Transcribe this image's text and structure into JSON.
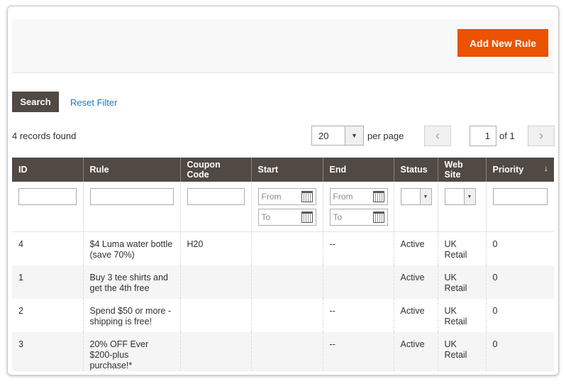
{
  "toolbar": {
    "add_label": "Add New Rule"
  },
  "filters": {
    "search_label": "Search",
    "reset_label": "Reset Filter"
  },
  "records_found": "4 records found",
  "pagination": {
    "per_page_value": "20",
    "per_page_label": "per page",
    "prev_icon": "‹",
    "next_icon": "›",
    "current_page": "1",
    "of_label": "of 1"
  },
  "grid": {
    "columns": [
      {
        "label": "ID"
      },
      {
        "label": "Rule"
      },
      {
        "label": "Coupon Code"
      },
      {
        "label": "Start"
      },
      {
        "label": "End"
      },
      {
        "label": "Status"
      },
      {
        "label": "Web Site"
      },
      {
        "label": "Priority"
      }
    ],
    "sort_icon": "↓",
    "date_from_placeholder": "From",
    "date_to_placeholder": "To",
    "rows": [
      {
        "id": "4",
        "rule": "$4 Luma water bottle (save 70%)",
        "coupon": "H20",
        "start": "",
        "end": "--",
        "status": "Active",
        "website": "UK Retail",
        "priority": "0"
      },
      {
        "id": "1",
        "rule": "Buy 3 tee shirts and get the 4th free",
        "coupon": "",
        "start": "",
        "end": "",
        "status": "Active",
        "website": "UK Retail",
        "priority": "0"
      },
      {
        "id": "2",
        "rule": "Spend $50 or more - shipping is free!",
        "coupon": "",
        "start": "",
        "end": "--",
        "status": "Active",
        "website": "UK Retail",
        "priority": "0"
      },
      {
        "id": "3",
        "rule": "20% OFF Ever $200-plus purchase!*",
        "coupon": "",
        "start": "",
        "end": "--",
        "status": "Active",
        "website": "UK Retail",
        "priority": "0"
      }
    ]
  }
}
